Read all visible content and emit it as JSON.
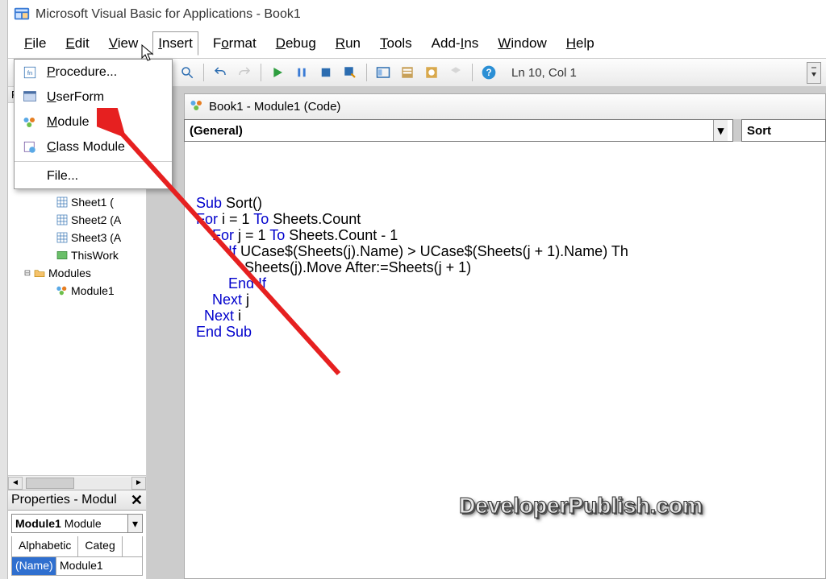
{
  "title": "Microsoft Visual Basic for Applications - Book1",
  "menubar": [
    "File",
    "Edit",
    "View",
    "Insert",
    "Format",
    "Debug",
    "Run",
    "Tools",
    "Add-Ins",
    "Window",
    "Help"
  ],
  "menubar_underline_idx": [
    0,
    0,
    0,
    0,
    1,
    0,
    0,
    0,
    4,
    0,
    0
  ],
  "insert_menu": {
    "items": [
      {
        "label": "Procedure...",
        "ul": 0
      },
      {
        "label": "UserForm",
        "ul": 0
      },
      {
        "label": "Module",
        "ul": 0
      },
      {
        "label": "Class Module",
        "ul": 0
      }
    ],
    "file_item": {
      "label": "File...",
      "ul": -1
    }
  },
  "toolbar_status": "Ln 10, Col 1",
  "project_pane_letter": "P",
  "tree": {
    "sheets": [
      "Sheet1 (",
      "Sheet2 (A",
      "Sheet3 (A"
    ],
    "thiswork": "ThisWork",
    "modules_folder": "Modules",
    "module1": "Module1"
  },
  "properties": {
    "title": "Properties - Modul",
    "dd_bold": "Module1",
    "dd_rest": "Module",
    "tabs": [
      "Alphabetic",
      "Categ"
    ],
    "rows": [
      {
        "name": "(Name)",
        "value": "Module1"
      }
    ]
  },
  "code_window": {
    "title": "Book1 - Module1 (Code)",
    "dd_left": "(General)",
    "dd_right": "Sort",
    "lines": [
      {
        "pre": "",
        "kw": "Sub",
        "rest": " Sort()"
      },
      {
        "pre": "",
        "kw": "For",
        "rest": " i = 1 To Sheets.Count"
      },
      {
        "pre": "    ",
        "kw": "For",
        "rest": " j = 1 To Sheets.Count - 1"
      },
      {
        "pre": "        ",
        "kw": "If",
        "rest": " UCase$(Sheets(j).Name) > UCase$(Sheets(j + 1).Name) Th"
      },
      {
        "pre": "            ",
        "kw": "",
        "rest": "Sheets(j).Move After:=Sheets(j + 1)"
      },
      {
        "pre": "        ",
        "kw": "End If",
        "rest": ""
      },
      {
        "pre": "    ",
        "kw": "Next",
        "rest": " j"
      },
      {
        "pre": "  ",
        "kw": "Next",
        "rest": " i"
      },
      {
        "pre": "",
        "kw": "End Sub",
        "rest": ""
      }
    ]
  },
  "watermark": "DeveloperPublish.com"
}
